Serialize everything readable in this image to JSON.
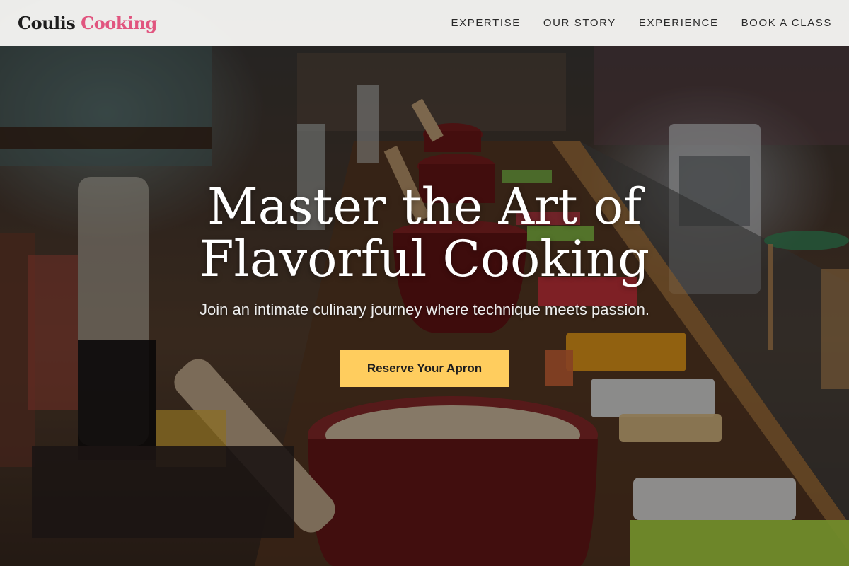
{
  "header": {
    "logo_primary": "Coulis",
    "logo_accent": "Cooking",
    "nav": [
      {
        "label": "EXPERTISE"
      },
      {
        "label": "OUR STORY"
      },
      {
        "label": "EXPERIENCE"
      },
      {
        "label": "BOOK A CLASS"
      }
    ]
  },
  "hero": {
    "title": "Master the Art of Flavorful Cooking",
    "subtitle": "Join an intimate culinary journey where technique meets passion.",
    "cta_label": "Reserve Your Apron",
    "background_icon": "cooking-class-photo"
  },
  "colors": {
    "logo_accent": "#e1557f",
    "cta_background": "#ffcd5e",
    "nav_background": "#f8f8f6",
    "nav_text": "#2a2a2a"
  }
}
